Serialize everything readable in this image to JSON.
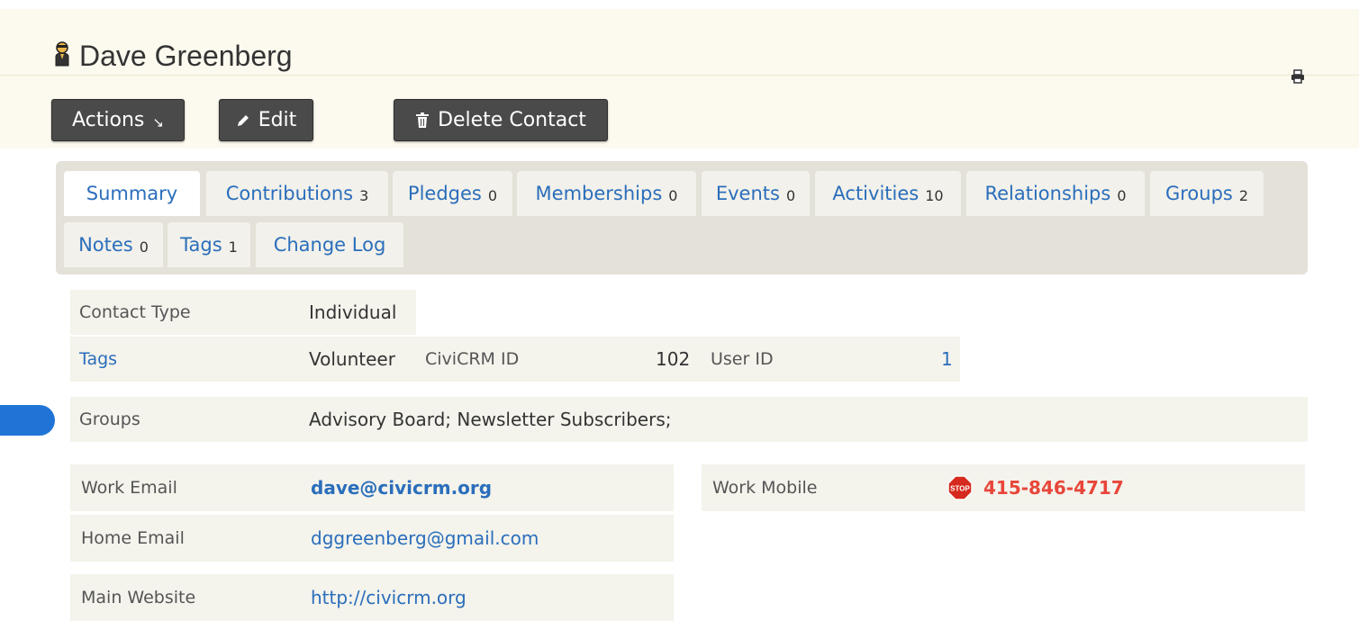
{
  "contact": {
    "name": "Dave Greenberg"
  },
  "toolbar": {
    "actions_label": "Actions",
    "actions_arrow": "↘",
    "edit_label": "Edit",
    "delete_label": "Delete Contact"
  },
  "tabs": [
    {
      "label": "Summary",
      "count": ""
    },
    {
      "label": "Contributions",
      "count": "3"
    },
    {
      "label": "Pledges",
      "count": "0"
    },
    {
      "label": "Memberships",
      "count": "0"
    },
    {
      "label": "Events",
      "count": "0"
    },
    {
      "label": "Activities",
      "count": "10"
    },
    {
      "label": "Relationships",
      "count": "0"
    },
    {
      "label": "Groups",
      "count": "2"
    },
    {
      "label": "Notes",
      "count": "0"
    },
    {
      "label": "Tags",
      "count": "1"
    },
    {
      "label": "Change Log",
      "count": ""
    }
  ],
  "summary": {
    "contact_type_label": "Contact Type",
    "contact_type_value": "Individual",
    "tags_label": "Tags",
    "tags_value": "Volunteer",
    "civicrm_id_label": "CiviCRM ID",
    "civicrm_id_value": "102",
    "user_id_label": "User ID",
    "user_id_value": "1",
    "groups_label": "Groups",
    "groups_value": "Advisory Board; Newsletter Subscribers;"
  },
  "communication": {
    "work_email_label": "Work Email",
    "work_email_value": "dave@civicrm.org",
    "home_email_label": "Home Email",
    "home_email_value": "dggreenberg@gmail.com",
    "main_website_label": "Main Website",
    "main_website_value": "http://civicrm.org",
    "work_mobile_label": "Work Mobile",
    "work_mobile_value": "415-846-4717",
    "stop_icon_text": "STOP"
  },
  "colors": {
    "link": "#2a6ebb",
    "phone_red": "#e8463a",
    "button_bg": "#4a4a4a",
    "highlight": "#1f74d6"
  }
}
